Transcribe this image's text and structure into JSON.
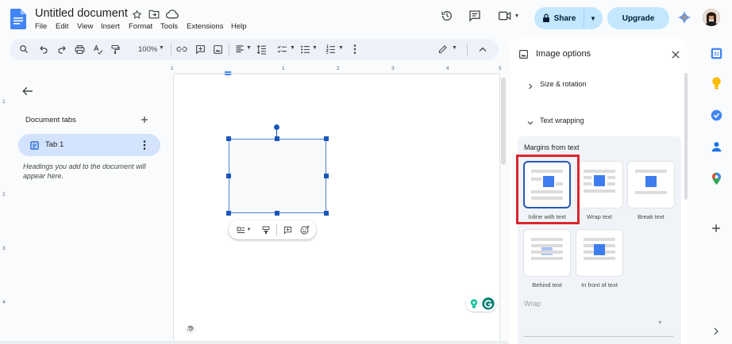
{
  "app": {
    "title": "Untitled document",
    "menus": [
      "File",
      "Edit",
      "View",
      "Insert",
      "Format",
      "Tools",
      "Extensions",
      "Help"
    ],
    "share_label": "Share",
    "upgrade_label": "Upgrade"
  },
  "toolbar": {
    "zoom": "100%"
  },
  "ruler": {
    "labels": [
      "1",
      "1",
      "2",
      "3",
      "4",
      "5"
    ]
  },
  "vruler": {
    "labels": [
      "1",
      "2",
      "3",
      "4"
    ]
  },
  "left_panel": {
    "title": "Document tabs",
    "tab_label": "Tab 1",
    "hint": "Headings you add to the document will appear here."
  },
  "image_options": {
    "title": "Image options",
    "sections": {
      "size_rotation": "Size & rotation",
      "text_wrapping": "Text wrapping"
    },
    "margins_label": "Margins from text",
    "wrap_options": [
      "Inline with text",
      "Wrap text",
      "Break text",
      "Behind text",
      "In front of text"
    ],
    "selected_option": "Inline with text",
    "wrap_label": "Wrap"
  },
  "colors": {
    "accent": "#c2e7ff",
    "tab_active": "#d3e3fd",
    "selection": "#1a56b8",
    "highlight_box": "#d9262b"
  }
}
